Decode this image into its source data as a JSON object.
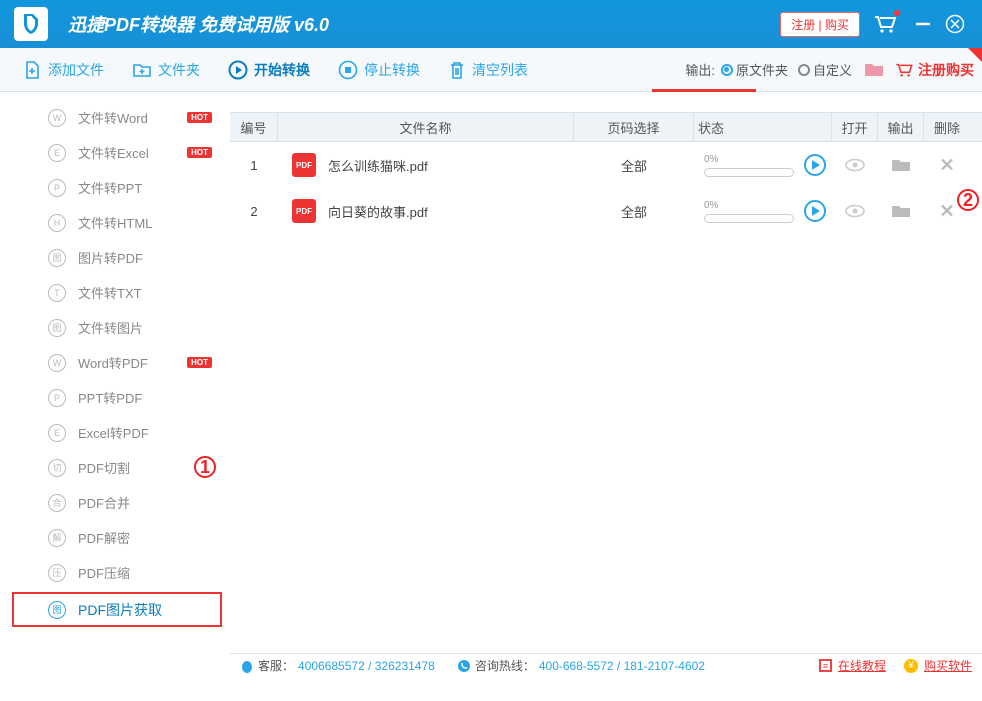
{
  "title": "迅捷PDF转换器 免费试用版 ",
  "version": "v6.0",
  "titlebar": {
    "register_buy": "注册 | 购买"
  },
  "toolbar": {
    "add_file": "添加文件",
    "add_folder": "文件夹",
    "start": "开始转换",
    "stop": "停止转换",
    "clear": "清空列表",
    "output_label": "输出:",
    "opt_source": "原文件夹",
    "opt_custom": "自定义",
    "register_buy": "注册购买"
  },
  "sidebar": [
    {
      "ic": "W",
      "label": "文件转Word",
      "hot": true
    },
    {
      "ic": "E",
      "label": "文件转Excel",
      "hot": true
    },
    {
      "ic": "P",
      "label": "文件转PPT"
    },
    {
      "ic": "H",
      "label": "文件转HTML"
    },
    {
      "ic": "图",
      "label": "图片转PDF"
    },
    {
      "ic": "T",
      "label": "文件转TXT"
    },
    {
      "ic": "图",
      "label": "文件转图片"
    },
    {
      "ic": "W",
      "label": "Word转PDF",
      "hot": true
    },
    {
      "ic": "P",
      "label": "PPT转PDF"
    },
    {
      "ic": "E",
      "label": "Excel转PDF"
    },
    {
      "ic": "切",
      "label": "PDF切割"
    },
    {
      "ic": "合",
      "label": "PDF合并"
    },
    {
      "ic": "解",
      "label": "PDF解密"
    },
    {
      "ic": "压",
      "label": "PDF压缩"
    },
    {
      "ic": "图",
      "label": "PDF图片获取",
      "active": true
    }
  ],
  "annotations": {
    "one": "1",
    "two": "2"
  },
  "columns": {
    "num": "编号",
    "name": "文件名称",
    "page": "页码选择",
    "status": "状态",
    "open": "打开",
    "output": "输出",
    "delete": "删除"
  },
  "rows": [
    {
      "num": "1",
      "name": "怎么训练猫咪.pdf",
      "page": "全部",
      "progress": "0%"
    },
    {
      "num": "2",
      "name": "向日葵的故事.pdf",
      "page": "全部",
      "progress": "0%"
    }
  ],
  "statusbar": {
    "service_label": "客服：",
    "service_value": "4006685572 / 326231478",
    "hotline_label": "咨询热线：",
    "hotline_value": "400-668-5572 / 181-2107-4602",
    "tutorial": "在线教程",
    "buy": "购买软件"
  }
}
